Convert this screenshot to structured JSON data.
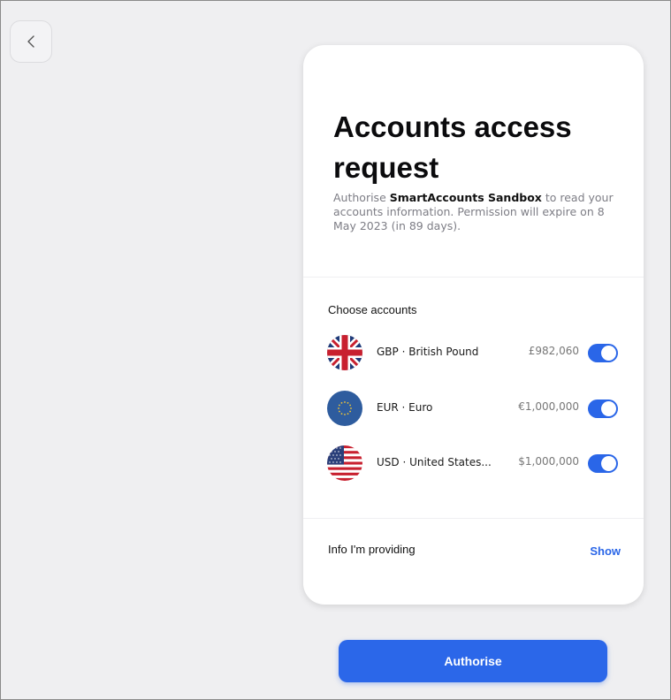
{
  "header": {
    "back_icon": "chevron-left-icon"
  },
  "card": {
    "title": "Accounts access request",
    "description": {
      "prefix": "Authorise ",
      "app_name": "SmartAccounts Sandbox",
      "suffix": " to read your accounts information. Permission will expire on 8 May 2023 (in 89 days)."
    },
    "choose_label": "Choose accounts",
    "accounts": [
      {
        "flag": "uk-flag-icon",
        "name": "GBP · British Pound",
        "balance": "£982,060",
        "selected": true
      },
      {
        "flag": "eu-flag-icon",
        "name": "EUR · Euro",
        "balance": "€1,000,000",
        "selected": true
      },
      {
        "flag": "us-flag-icon",
        "name": "USD · United States...",
        "balance": "$1,000,000",
        "selected": true
      }
    ],
    "info_label": "Info I'm providing",
    "show_link": "Show"
  },
  "footer": {
    "authorise_label": "Authorise"
  },
  "colors": {
    "accent": "#2b67e9",
    "background": "#efeff1",
    "card": "#ffffff"
  }
}
